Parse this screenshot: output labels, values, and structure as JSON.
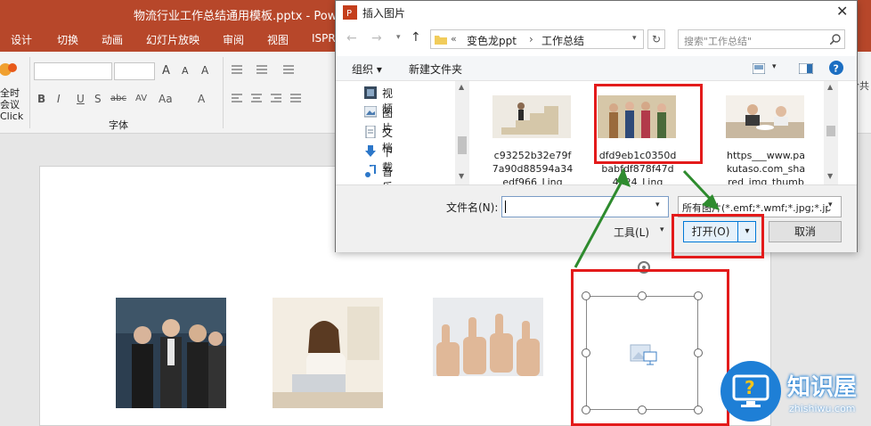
{
  "app": {
    "title": "物流行业工作总结通用模板.pptx - PowerP",
    "tabs": [
      "设计",
      "切换",
      "动画",
      "幻灯片放映",
      "审阅",
      "视图",
      "ISPR"
    ],
    "ribbon": {
      "font_group_label": "字体",
      "left_btn_lines": [
        "全时",
        "会议",
        "Click"
      ],
      "right_cut": "合共"
    }
  },
  "dialog": {
    "title": "插入图片",
    "path": [
      "«",
      "变色龙ppt",
      "›",
      "工作总结"
    ],
    "search_placeholder": "搜索\"工作总结\"",
    "organize": "组织 ▾",
    "new_folder": "新建文件夹",
    "nav_items": [
      "视频",
      "图片",
      "文档",
      "下载",
      "音乐"
    ],
    "files": [
      {
        "name": "c93252b32e79f\n7a90d88594a34\nedf966_Ling"
      },
      {
        "name": "dfd9eb1c0350d\nbabfdf878f47d\n4524_Ling"
      },
      {
        "name": "https___www.pa\nkutaso.com_sha\nred_img_thumb"
      }
    ],
    "filename_label": "文件名(N):",
    "filename_value": "",
    "filter": "所有图片(*.emf;*.wmf;*.jpg;*.jp",
    "tools": "工具(L)",
    "open": "打开(O)",
    "cancel": "取消"
  },
  "watermark": {
    "name": "知识屋",
    "url": "zhishiwu.com"
  },
  "colors": {
    "ppt_red": "#b7472a",
    "highlight_red": "#e31b1b",
    "arrow_green": "#2e8b2e",
    "logo_blue": "#1e7fd6"
  }
}
